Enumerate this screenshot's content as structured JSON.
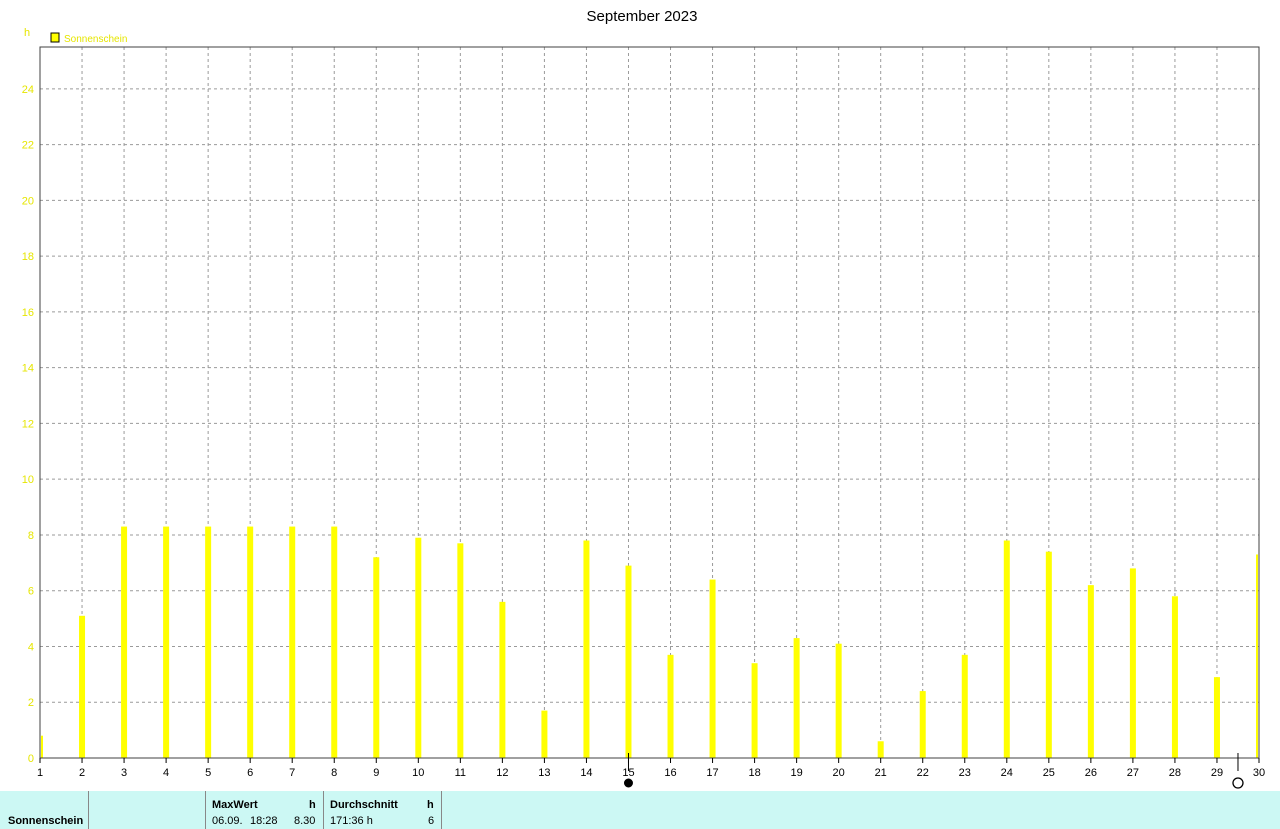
{
  "chart_data": {
    "type": "bar",
    "title": "September 2023",
    "ylabel": "h",
    "ylim": [
      0,
      25.5
    ],
    "yticks": [
      0,
      2,
      4,
      6,
      8,
      10,
      12,
      14,
      16,
      18,
      20,
      22,
      24
    ],
    "grid": true,
    "legend_position": "top-left",
    "series": [
      {
        "name": "Sonnenschein",
        "color": "#ffff00",
        "x": [
          1,
          2,
          3,
          4,
          5,
          6,
          7,
          8,
          9,
          10,
          11,
          12,
          13,
          14,
          15,
          16,
          17,
          18,
          19,
          20,
          21,
          22,
          23,
          24,
          25,
          26,
          27,
          28,
          29,
          30
        ],
        "values": [
          0.8,
          5.1,
          8.3,
          8.3,
          8.3,
          8.3,
          8.3,
          8.3,
          7.2,
          7.9,
          7.7,
          5.6,
          1.7,
          7.8,
          6.9,
          3.7,
          6.4,
          3.4,
          4.3,
          4.1,
          0.6,
          2.4,
          3.7,
          7.8,
          7.4,
          6.2,
          6.8,
          5.8,
          2.9,
          7.3
        ]
      }
    ],
    "moon_phases": [
      {
        "day": 15,
        "phase": "new-moon"
      },
      {
        "day": 29.5,
        "phase": "full-moon"
      }
    ]
  },
  "colors": {
    "sunshine": "#ffff00",
    "ytick": "#e6e600",
    "footer_bg": "#ccf8f4"
  },
  "footer": {
    "row_label": "Sonnenschein",
    "max_header": "MaxWert",
    "max_unit": "h",
    "max_date": "06.09.",
    "max_time": "18:28",
    "max_value": "8.30",
    "avg_header": "Durchschnitt",
    "avg_unit": "h",
    "sum_value": "171:36 h",
    "avg_value": "6"
  }
}
